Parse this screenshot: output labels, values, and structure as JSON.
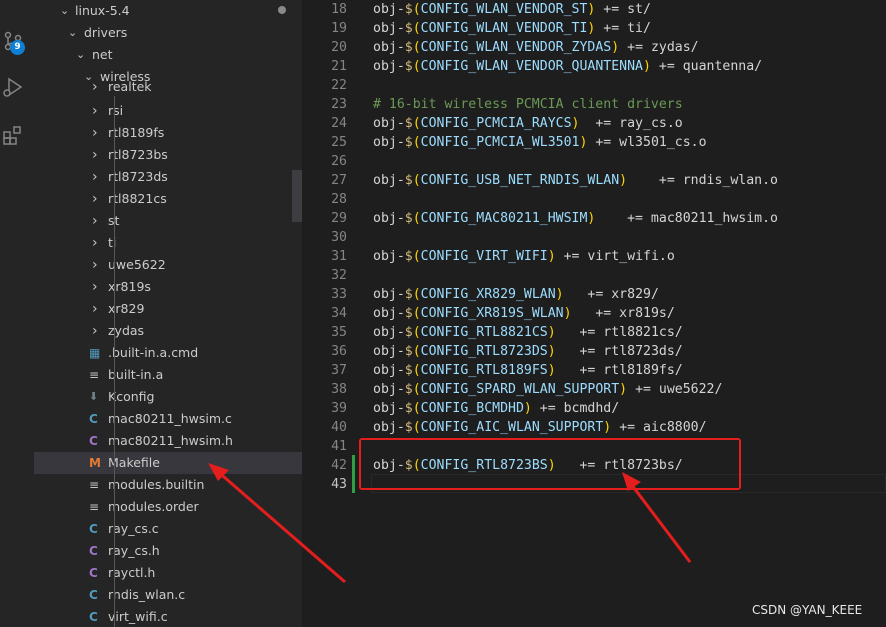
{
  "explorer": {
    "root": "linux-5.4",
    "drivers": "drivers",
    "net": "net",
    "wireless": "wireless",
    "items": [
      {
        "label": "realtek",
        "kind": "folder",
        "icon": "chevron-right-icon"
      },
      {
        "label": "rsi",
        "kind": "folder",
        "icon": "chevron-right-icon"
      },
      {
        "label": "rtl8189fs",
        "kind": "folder",
        "icon": "chevron-right-icon"
      },
      {
        "label": "rtl8723bs",
        "kind": "folder",
        "icon": "chevron-right-icon"
      },
      {
        "label": "rtl8723ds",
        "kind": "folder",
        "icon": "chevron-right-icon"
      },
      {
        "label": "rtl8821cs",
        "kind": "folder",
        "icon": "chevron-right-icon"
      },
      {
        "label": "st",
        "kind": "folder",
        "icon": "chevron-right-icon"
      },
      {
        "label": "ti",
        "kind": "folder",
        "icon": "chevron-right-icon"
      },
      {
        "label": "uwe5622",
        "kind": "folder",
        "icon": "chevron-right-icon"
      },
      {
        "label": "xr819s",
        "kind": "folder",
        "icon": "chevron-right-icon"
      },
      {
        "label": "xr829",
        "kind": "folder",
        "icon": "chevron-right-icon"
      },
      {
        "label": "zydas",
        "kind": "folder",
        "icon": "chevron-right-icon"
      },
      {
        "label": ".built-in.a.cmd",
        "kind": "file",
        "icon": "windows-cmd-icon"
      },
      {
        "label": "built-in.a",
        "kind": "file",
        "icon": "lines-file-icon"
      },
      {
        "label": "Kconfig",
        "kind": "file",
        "icon": "download-arrow-icon"
      },
      {
        "label": "mac80211_hwsim.c",
        "kind": "file",
        "icon": "c-file-icon"
      },
      {
        "label": "mac80211_hwsim.h",
        "kind": "file",
        "icon": "h-file-icon"
      },
      {
        "label": "Makefile",
        "kind": "file",
        "icon": "makefile-icon",
        "selected": true
      },
      {
        "label": "modules.builtin",
        "kind": "file",
        "icon": "lines-file-icon"
      },
      {
        "label": "modules.order",
        "kind": "file",
        "icon": "lines-file-icon"
      },
      {
        "label": "ray_cs.c",
        "kind": "file",
        "icon": "c-file-icon"
      },
      {
        "label": "ray_cs.h",
        "kind": "file",
        "icon": "h-file-icon"
      },
      {
        "label": "rayctl.h",
        "kind": "file",
        "icon": "h-file-icon"
      },
      {
        "label": "rndis_wlan.c",
        "kind": "file",
        "icon": "c-file-icon"
      },
      {
        "label": "virt_wifi.c",
        "kind": "file",
        "icon": "c-file-icon"
      }
    ],
    "icon_glyphs": {
      "c": "C",
      "m": "M"
    }
  },
  "activity_bar": {
    "source_control_badge": "9"
  },
  "editor": {
    "lines": [
      {
        "n": "18",
        "t": "obj-$(CONFIG_WLAN_VENDOR_ST) += st/"
      },
      {
        "n": "19",
        "t": "obj-$(CONFIG_WLAN_VENDOR_TI) += ti/"
      },
      {
        "n": "20",
        "t": "obj-$(CONFIG_WLAN_VENDOR_ZYDAS) += zydas/"
      },
      {
        "n": "21",
        "t": "obj-$(CONFIG_WLAN_VENDOR_QUANTENNA) += quantenna/"
      },
      {
        "n": "22",
        "t": ""
      },
      {
        "n": "23",
        "t": "# 16-bit wireless PCMCIA client drivers"
      },
      {
        "n": "24",
        "t": "obj-$(CONFIG_PCMCIA_RAYCS)  += ray_cs.o"
      },
      {
        "n": "25",
        "t": "obj-$(CONFIG_PCMCIA_WL3501) += wl3501_cs.o"
      },
      {
        "n": "26",
        "t": ""
      },
      {
        "n": "27",
        "t": "obj-$(CONFIG_USB_NET_RNDIS_WLAN)    += rndis_wlan.o"
      },
      {
        "n": "28",
        "t": ""
      },
      {
        "n": "29",
        "t": "obj-$(CONFIG_MAC80211_HWSIM)    += mac80211_hwsim.o"
      },
      {
        "n": "30",
        "t": ""
      },
      {
        "n": "31",
        "t": "obj-$(CONFIG_VIRT_WIFI) += virt_wifi.o"
      },
      {
        "n": "32",
        "t": ""
      },
      {
        "n": "33",
        "t": "obj-$(CONFIG_XR829_WLAN)   += xr829/"
      },
      {
        "n": "34",
        "t": "obj-$(CONFIG_XR819S_WLAN)   += xr819s/"
      },
      {
        "n": "35",
        "t": "obj-$(CONFIG_RTL8821CS)   += rtl8821cs/"
      },
      {
        "n": "36",
        "t": "obj-$(CONFIG_RTL8723DS)   += rtl8723ds/"
      },
      {
        "n": "37",
        "t": "obj-$(CONFIG_RTL8189FS)   += rtl8189fs/"
      },
      {
        "n": "38",
        "t": "obj-$(CONFIG_SPARD_WLAN_SUPPORT) += uwe5622/"
      },
      {
        "n": "39",
        "t": "obj-$(CONFIG_BCMDHD) += bcmdhd/"
      },
      {
        "n": "40",
        "t": "obj-$(CONFIG_AIC_WLAN_SUPPORT) += aic8800/"
      },
      {
        "n": "41",
        "t": ""
      },
      {
        "n": "42",
        "t": "obj-$(CONFIG_RTL8723BS)   += rtl8723bs/"
      },
      {
        "n": "43",
        "t": ""
      }
    ],
    "current_line": "43"
  },
  "watermark": "CSDN @YAN_KEEE",
  "colors": {
    "annotation_red": "#e41d1d",
    "selection": "#37373d",
    "badge": "#0e7fd2"
  }
}
